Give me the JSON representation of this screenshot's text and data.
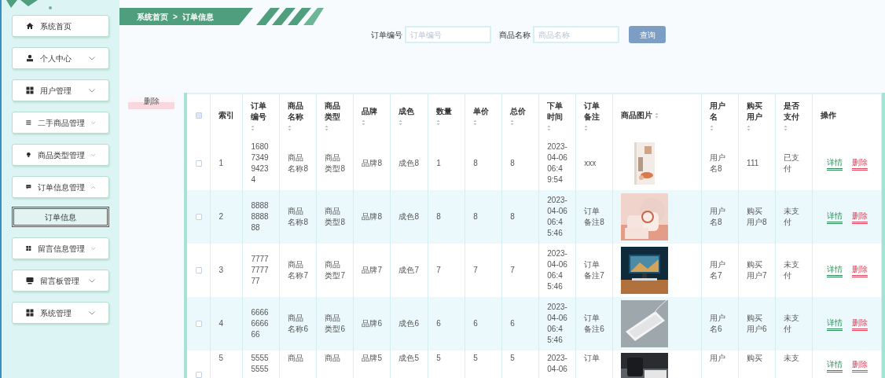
{
  "sidebar": {
    "items": [
      {
        "label": "系统首页",
        "kind": "link"
      },
      {
        "label": "个人中心",
        "kind": "group",
        "expanded": false
      },
      {
        "label": "用户管理",
        "kind": "group",
        "expanded": false
      },
      {
        "label": "二手商品管理",
        "kind": "group",
        "expanded": false
      },
      {
        "label": "商品类型管理",
        "kind": "group",
        "expanded": false
      },
      {
        "label": "订单信息管理",
        "kind": "group",
        "expanded": true,
        "children": [
          {
            "label": "订单信息",
            "selected": true
          }
        ]
      },
      {
        "label": "留言信息管理",
        "kind": "group",
        "expanded": false
      },
      {
        "label": "留言板管理",
        "kind": "group",
        "expanded": false
      },
      {
        "label": "系统管理",
        "kind": "group",
        "expanded": false
      }
    ]
  },
  "breadcrumb": {
    "items": [
      "系统首页",
      "订单信息"
    ],
    "separator": ">"
  },
  "search": {
    "fields": [
      {
        "label": "订单编号",
        "placeholder": "订单编号"
      },
      {
        "label": "商品名称",
        "placeholder": "商品名称"
      }
    ],
    "button": "查询"
  },
  "delete_button": "删除",
  "table": {
    "header_checked": false,
    "columns": [
      {
        "label": "索引",
        "sortable": false,
        "kind": "text"
      },
      {
        "label": "订单编号",
        "sortable": true,
        "kind": "text"
      },
      {
        "label": "商品名称",
        "sortable": true,
        "kind": "text"
      },
      {
        "label": "商品类型",
        "sortable": true,
        "kind": "text"
      },
      {
        "label": "品牌",
        "sortable": true,
        "kind": "text"
      },
      {
        "label": "成色",
        "sortable": true,
        "kind": "text"
      },
      {
        "label": "数量",
        "sortable": true,
        "kind": "text"
      },
      {
        "label": "单价",
        "sortable": true,
        "kind": "text"
      },
      {
        "label": "总价",
        "sortable": true,
        "kind": "text"
      },
      {
        "label": "下单时间",
        "sortable": true,
        "kind": "text"
      },
      {
        "label": "订单备注",
        "sortable": true,
        "kind": "text"
      },
      {
        "label": "商品图片",
        "sortable": true,
        "kind": "picture"
      },
      {
        "label": "用户名",
        "sortable": true,
        "kind": "text"
      },
      {
        "label": "购买用户",
        "sortable": true,
        "kind": "text"
      },
      {
        "label": "是否支付",
        "sortable": true,
        "kind": "text"
      },
      {
        "label": "操作",
        "sortable": false,
        "kind": "actions"
      }
    ],
    "rows": [
      {
        "checked": false,
        "cells": [
          "1",
          "1680734994234",
          "商品名称8",
          "商品类型8",
          "品牌8",
          "成色8",
          "1",
          "8",
          "8",
          "2023-04-06 06:49:54",
          "xxx",
          "",
          "用户名8",
          "111",
          "已支付",
          ""
        ],
        "actions": [
          "详情",
          "删除"
        ]
      },
      {
        "checked": false,
        "cells": [
          "2",
          "8888888888",
          "商品名称8",
          "商品类型8",
          "品牌8",
          "成色8",
          "8",
          "8",
          "8",
          "2023-04-06 06:45:46",
          "订单备注8",
          "",
          "用户名8",
          "购买用户8",
          "未支付",
          ""
        ],
        "actions": [
          "详情",
          "删除"
        ]
      },
      {
        "checked": false,
        "cells": [
          "3",
          "7777777777",
          "商品名称7",
          "商品类型7",
          "品牌7",
          "成色7",
          "7",
          "7",
          "7",
          "2023-04-06 06:45:46",
          "订单备注7",
          "",
          "用户名7",
          "购买用户7",
          "未支付",
          ""
        ],
        "actions": [
          "详情",
          "删除"
        ]
      },
      {
        "checked": false,
        "cells": [
          "4",
          "6666666666",
          "商品名称6",
          "商品类型6",
          "品牌6",
          "成色6",
          "6",
          "6",
          "6",
          "2023-04-06 06:45:46",
          "订单备注6",
          "",
          "用户名6",
          "购买用户6",
          "未支付",
          ""
        ],
        "actions": [
          "详情",
          "删除"
        ]
      },
      {
        "checked": false,
        "cells": [
          "5",
          "55555555",
          "商品",
          "商品",
          "品牌5",
          "成色5",
          "5",
          "5",
          "5",
          "2023-04-06",
          "订单",
          "",
          "用户",
          "购买",
          "未支",
          ""
        ],
        "actions": [
          "详情",
          "删除"
        ]
      }
    ]
  }
}
